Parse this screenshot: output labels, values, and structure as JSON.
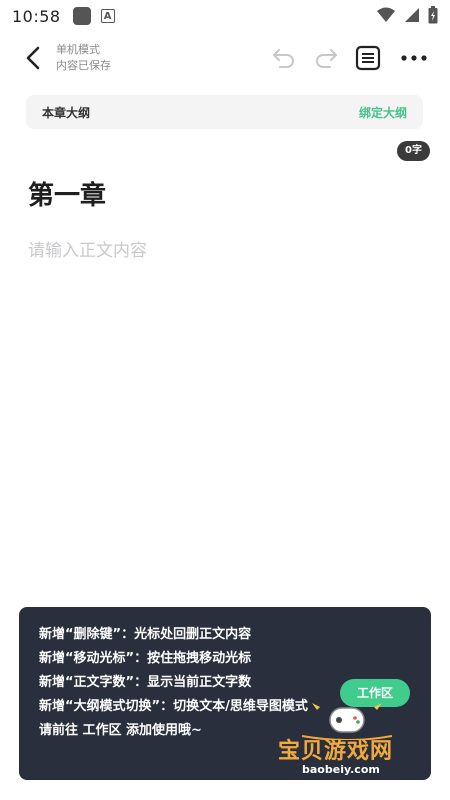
{
  "status_bar": {
    "time": "10:58"
  },
  "header": {
    "mode_title": "单机模式",
    "save_status": "内容已保存"
  },
  "outline_bar": {
    "label": "本章大纲",
    "bind_label": "绑定大纲"
  },
  "editor": {
    "word_count": "0字",
    "chapter_title": "第一章",
    "body_placeholder": "请输入正文内容",
    "body_value": ""
  },
  "tips": {
    "lines": [
      "新增“删除键”：光标处回删正文内容",
      "新增“移动光标”：按住拖拽移动光标",
      "新增“正文字数”：显示当前正文字数",
      "新增“大纲模式切换”：切换文本/思维导图模式",
      "请前往 工作区 添加使用哦~"
    ],
    "work_button_label": "工作区"
  },
  "watermark": {
    "text": "宝贝游戏网",
    "url": "baobeiy.com"
  },
  "colors": {
    "accent_green": "#46c28e",
    "panel_bg": "#2a2f3d",
    "button_green": "#3fcc8d"
  },
  "icons": [
    "back-arrow-icon",
    "undo-icon",
    "redo-icon",
    "outline-list-icon",
    "more-dots-icon",
    "wifi-icon",
    "signal-icon",
    "battery-icon"
  ]
}
